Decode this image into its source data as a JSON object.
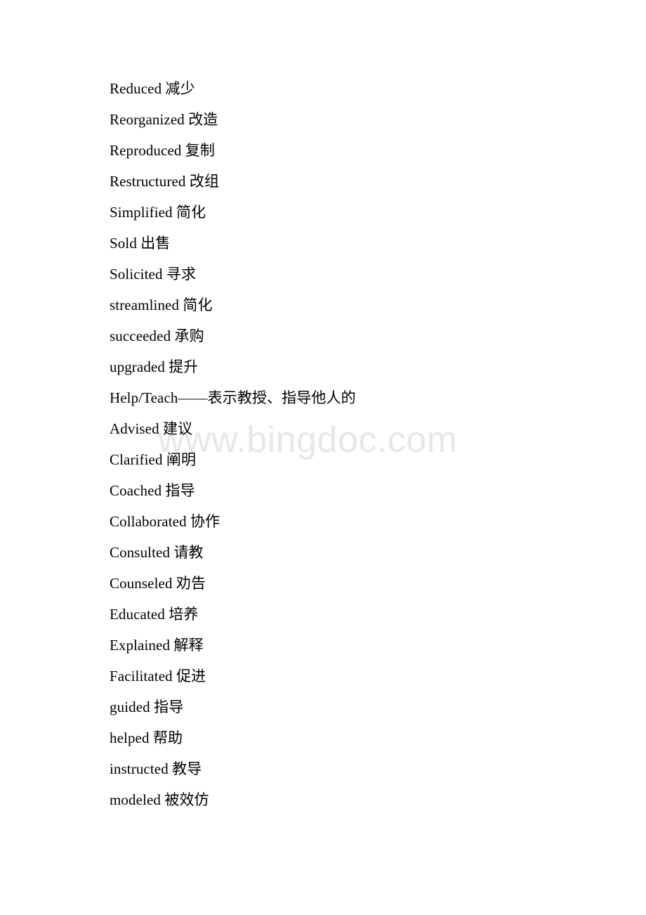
{
  "document": {
    "background_color": "#ffffff",
    "text_color": "#000000",
    "lines": [
      {
        "id": "line-1",
        "text": "Reduced 减少"
      },
      {
        "id": "line-2",
        "text": "Reorganized 改造"
      },
      {
        "id": "line-3",
        "text": "Reproduced 复制"
      },
      {
        "id": "line-4",
        "text": "Restructured 改组"
      },
      {
        "id": "line-5",
        "text": "Simplified 简化"
      },
      {
        "id": "line-6",
        "text": "Sold 出售"
      },
      {
        "id": "line-7",
        "text": "Solicited 寻求"
      },
      {
        "id": "line-8",
        "text": "streamlined 简化"
      },
      {
        "id": "line-9",
        "text": "succeeded 承购"
      },
      {
        "id": "line-10",
        "text": "upgraded 提升"
      },
      {
        "id": "line-11",
        "text": "Help/Teach——表示教授、指导他人的"
      },
      {
        "id": "line-12",
        "text": "Advised 建议"
      },
      {
        "id": "line-13",
        "text": "Clarified 阐明"
      },
      {
        "id": "line-14",
        "text": "Coached 指导"
      },
      {
        "id": "line-15",
        "text": "Collaborated 协作"
      },
      {
        "id": "line-16",
        "text": "Consulted 请教"
      },
      {
        "id": "line-17",
        "text": "Counseled 劝告"
      },
      {
        "id": "line-18",
        "text": "Educated 培养"
      },
      {
        "id": "line-19",
        "text": "Explained 解释"
      },
      {
        "id": "line-20",
        "text": "Facilitated 促进"
      },
      {
        "id": "line-21",
        "text": "guided 指导"
      },
      {
        "id": "line-22",
        "text": "helped 帮助"
      },
      {
        "id": "line-23",
        "text": "instructed 教导"
      },
      {
        "id": "line-24",
        "text": "modeled 被效仿"
      }
    ]
  },
  "watermark": {
    "text": "www.bingdoc.com",
    "color": "#e7e7e7"
  }
}
